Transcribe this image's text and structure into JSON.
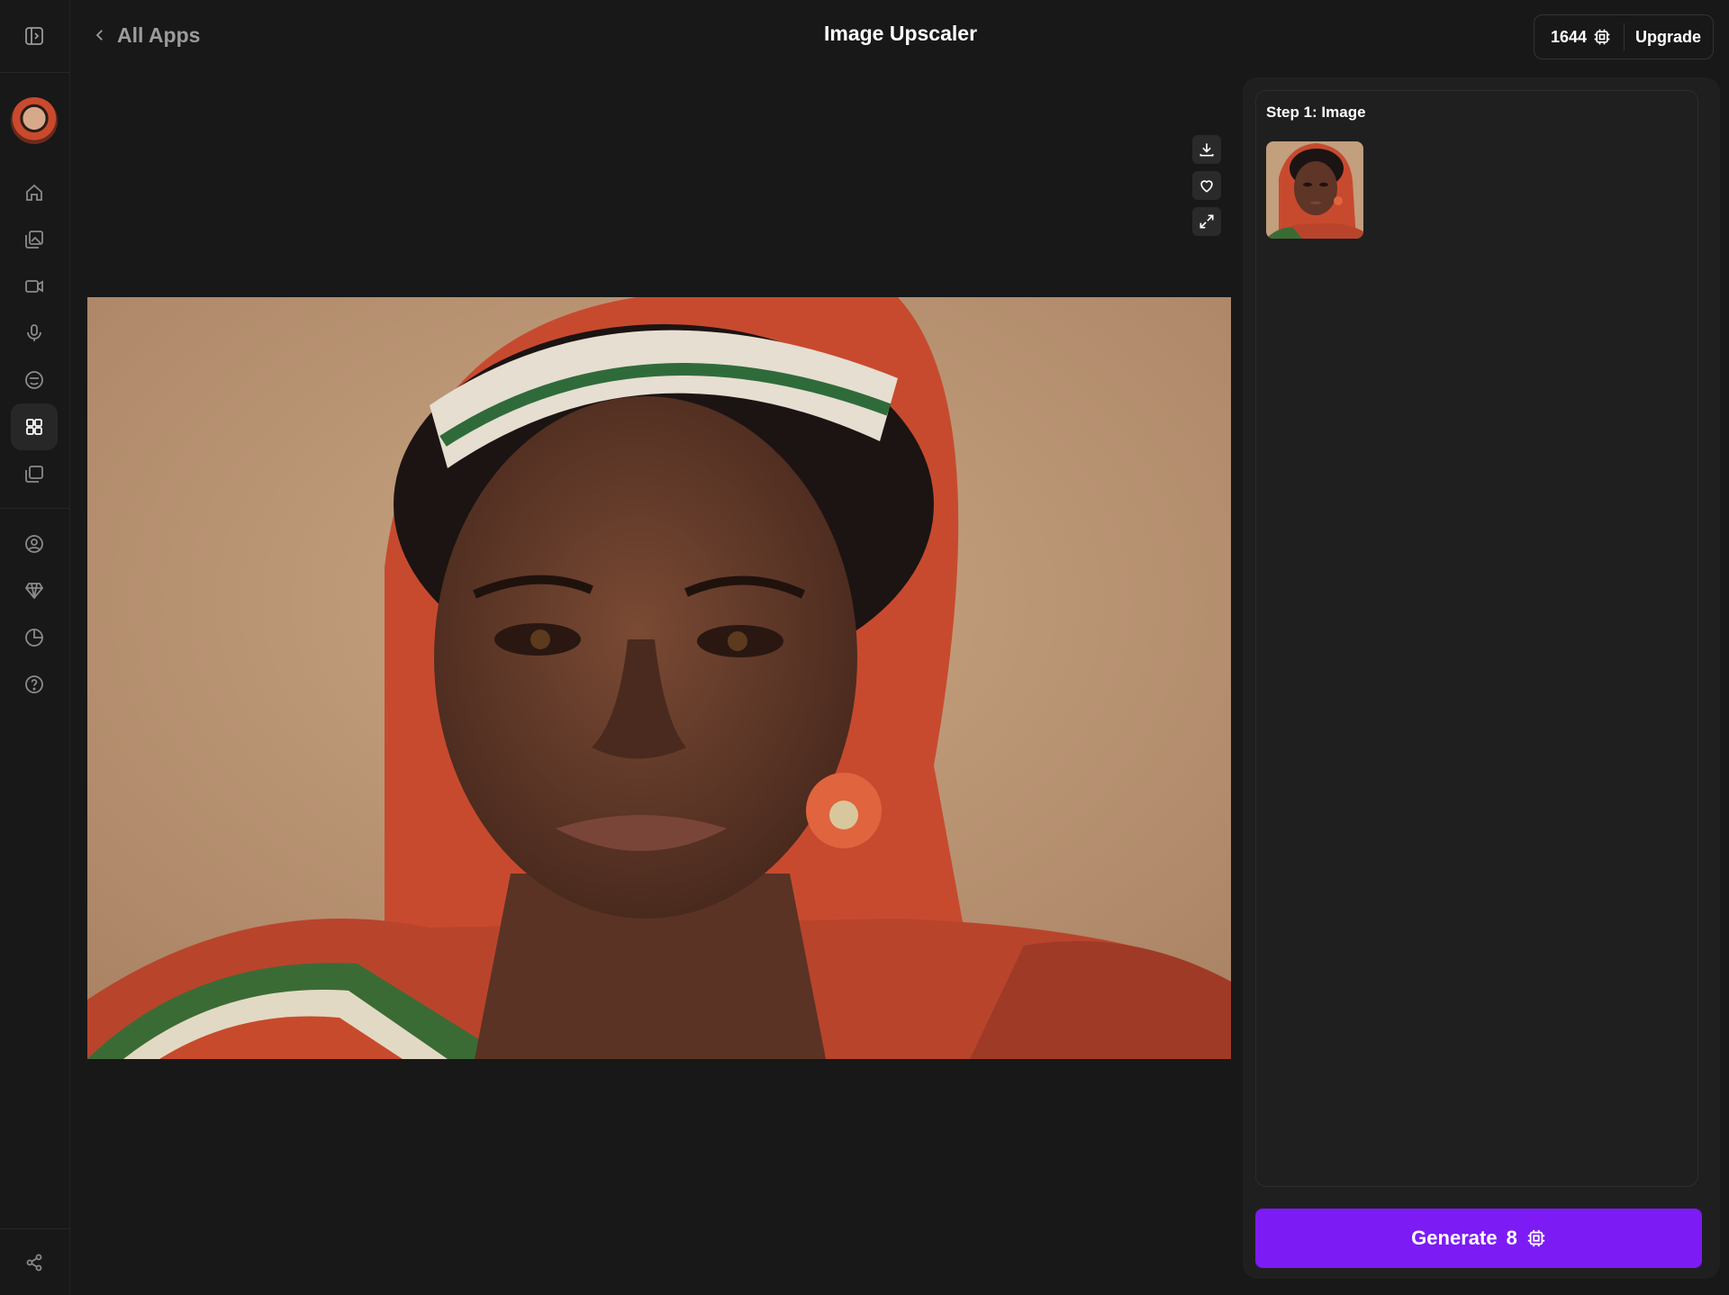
{
  "header": {
    "back_label": "All Apps",
    "title": "Image Upscaler",
    "credits": "1644",
    "upgrade_label": "Upgrade"
  },
  "sidebar": {
    "items": [
      {
        "name": "home",
        "icon": "home-icon"
      },
      {
        "name": "image",
        "icon": "image-icon"
      },
      {
        "name": "video",
        "icon": "video-icon"
      },
      {
        "name": "audio",
        "icon": "microphone-icon"
      },
      {
        "name": "character",
        "icon": "face-icon"
      },
      {
        "name": "apps",
        "icon": "grid-icon",
        "active": true
      },
      {
        "name": "library",
        "icon": "folders-icon"
      },
      {
        "name": "account",
        "icon": "user-circle-icon"
      },
      {
        "name": "plans",
        "icon": "diamond-icon"
      },
      {
        "name": "usage",
        "icon": "pie-chart-icon"
      },
      {
        "name": "help",
        "icon": "help-icon"
      }
    ]
  },
  "panel": {
    "step_title": "Step 1: Image",
    "generate_label": "Generate",
    "generate_cost": "8"
  },
  "colors": {
    "background": "#181818",
    "panel": "#1f1f1f",
    "accent": "#7c1bf4"
  }
}
